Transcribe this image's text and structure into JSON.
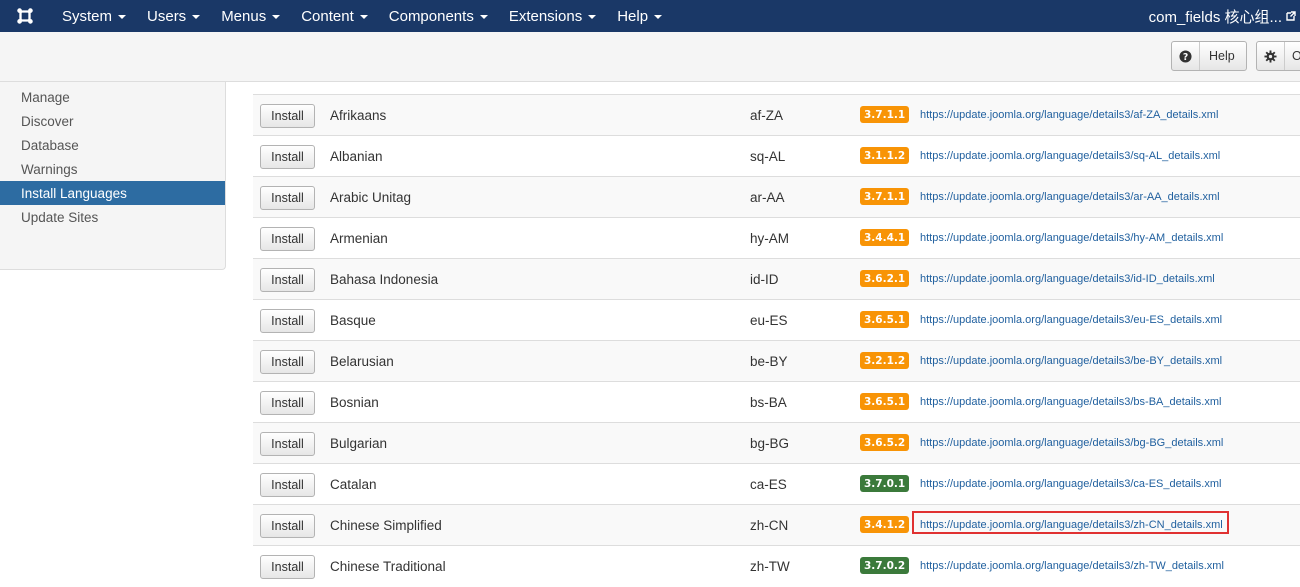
{
  "navbar": {
    "brand_icon": "joomla-logo-icon",
    "menus": [
      {
        "label": "System"
      },
      {
        "label": "Users"
      },
      {
        "label": "Menus"
      },
      {
        "label": "Content"
      },
      {
        "label": "Components"
      },
      {
        "label": "Extensions"
      },
      {
        "label": "Help"
      }
    ],
    "site_title": "com_fields 核心组...",
    "site_icon": "external-link-icon"
  },
  "toolbar": {
    "help_label": "Help",
    "help_icon": "question-circle-icon",
    "options_label": "O",
    "options_icon": "gear-icon"
  },
  "sidebar": {
    "items": [
      {
        "label": "Manage",
        "active": false
      },
      {
        "label": "Discover",
        "active": false
      },
      {
        "label": "Database",
        "active": false
      },
      {
        "label": "Warnings",
        "active": false
      },
      {
        "label": "Install Languages",
        "active": true
      },
      {
        "label": "Update Sites",
        "active": false
      }
    ],
    "active_color": "#2d6ca2"
  },
  "table": {
    "install_label": "Install",
    "badge_colors": {
      "orange": "#f89406",
      "green": "#3b7a3b"
    },
    "rows": [
      {
        "name": "Afrikaans",
        "tag": "af-ZA",
        "version": "3.7.1.1",
        "status": "orange",
        "url": "https://update.joomla.org/language/details3/af-ZA_details.xml"
      },
      {
        "name": "Albanian",
        "tag": "sq-AL",
        "version": "3.1.1.2",
        "status": "orange",
        "url": "https://update.joomla.org/language/details3/sq-AL_details.xml"
      },
      {
        "name": "Arabic Unitag",
        "tag": "ar-AA",
        "version": "3.7.1.1",
        "status": "orange",
        "url": "https://update.joomla.org/language/details3/ar-AA_details.xml"
      },
      {
        "name": "Armenian",
        "tag": "hy-AM",
        "version": "3.4.4.1",
        "status": "orange",
        "url": "https://update.joomla.org/language/details3/hy-AM_details.xml"
      },
      {
        "name": "Bahasa Indonesia",
        "tag": "id-ID",
        "version": "3.6.2.1",
        "status": "orange",
        "url": "https://update.joomla.org/language/details3/id-ID_details.xml"
      },
      {
        "name": "Basque",
        "tag": "eu-ES",
        "version": "3.6.5.1",
        "status": "orange",
        "url": "https://update.joomla.org/language/details3/eu-ES_details.xml"
      },
      {
        "name": "Belarusian",
        "tag": "be-BY",
        "version": "3.2.1.2",
        "status": "orange",
        "url": "https://update.joomla.org/language/details3/be-BY_details.xml"
      },
      {
        "name": "Bosnian",
        "tag": "bs-BA",
        "version": "3.6.5.1",
        "status": "orange",
        "url": "https://update.joomla.org/language/details3/bs-BA_details.xml"
      },
      {
        "name": "Bulgarian",
        "tag": "bg-BG",
        "version": "3.6.5.2",
        "status": "orange",
        "url": "https://update.joomla.org/language/details3/bg-BG_details.xml"
      },
      {
        "name": "Catalan",
        "tag": "ca-ES",
        "version": "3.7.0.1",
        "status": "green",
        "url": "https://update.joomla.org/language/details3/ca-ES_details.xml"
      },
      {
        "name": "Chinese Simplified",
        "tag": "zh-CN",
        "version": "3.4.1.2",
        "status": "orange",
        "url": "https://update.joomla.org/language/details3/zh-CN_details.xml",
        "highlighted": true
      },
      {
        "name": "Chinese Traditional",
        "tag": "zh-TW",
        "version": "3.7.0.2",
        "status": "green",
        "url": "https://update.joomla.org/language/details3/zh-TW_details.xml"
      }
    ]
  }
}
